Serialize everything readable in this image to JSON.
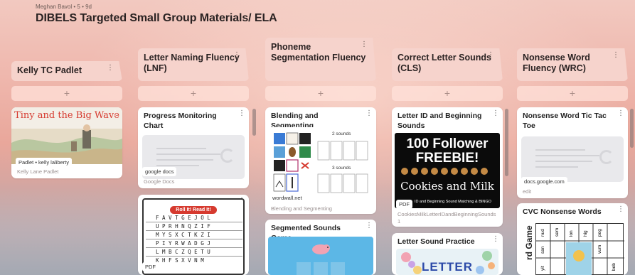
{
  "header": {
    "meta": "Meghan Bavol • 5 • 9d",
    "title": "DIBELS Targeted Small Group Materials/ ELA"
  },
  "columns": [
    {
      "name": "Kelly TC Padlet",
      "add": "+",
      "cards": [
        {
          "title": "",
          "image_title": "Tiny and the Big Wave",
          "pill": "Padlet • kelly laliberty",
          "source": "Kelly Lane Padlet"
        }
      ]
    },
    {
      "name": "Letter Naming Fluency (LNF)",
      "add": "+",
      "cards": [
        {
          "title": "Progress Monitoring Chart",
          "pill": "google docs",
          "source": "Google Docs"
        },
        {
          "title": "",
          "image_title": "Roll It! Read It!",
          "pill": "PDF",
          "letters": [
            "F A V T G E J O L",
            "U P R H N Q Z I F",
            "M Y S X C T K Z I",
            "P I Y R W A D G J",
            "L M B C Z Q E T U",
            "K H F S X V N M"
          ]
        }
      ]
    },
    {
      "name": "Phoneme Segmentation Fluency",
      "add": "+",
      "cards": [
        {
          "title": "Blending and Segmenting",
          "label_a": "2 sounds",
          "label_b": "3 sounds",
          "pill": "wordwall.net",
          "source": "Blending and Segmenting"
        },
        {
          "title": "Segmented Sounds Game"
        }
      ]
    },
    {
      "name": "Correct Letter Sounds (CLS)",
      "add": "+",
      "cards": [
        {
          "title": "Letter ID and Beginning Sounds",
          "image_line1": "100 Follower",
          "image_line2": "FREEBIE!",
          "image_line3": "Cookies and Milk",
          "image_line4": "ID and Beginning Sound Matching & BINGO",
          "pill": "PDF",
          "source": "CookiesMilkLetterIDandBeginningSounds 1"
        },
        {
          "title": "Letter Sound Practice",
          "image_word": "LETTER"
        }
      ]
    },
    {
      "name": "Nonsense Word Fluency (WRC)",
      "add": "+",
      "cards": [
        {
          "title": "Nonsense Word Tic Tac Toe",
          "pill": "docs.google.com",
          "source": "edit"
        },
        {
          "title": "CVC Nonsense Words",
          "side_label": "rd Game",
          "cells": [
            "nud",
            "sem",
            "lon",
            "hig",
            "pog",
            "san",
            "vum",
            "yit",
            "beb"
          ]
        }
      ]
    }
  ],
  "icons": {
    "more": "⋮"
  }
}
